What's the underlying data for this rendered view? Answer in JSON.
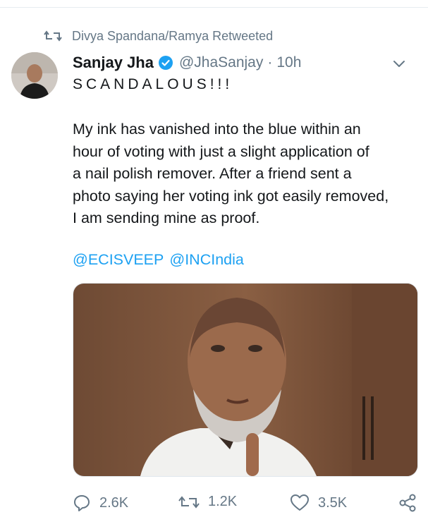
{
  "retweet": {
    "label": "Divya Spandana/Ramya Retweeted"
  },
  "tweet": {
    "author_name": "Sanjay Jha",
    "handle": "@JhaSanjay",
    "separator": "·",
    "time": "10h",
    "headline": "SCANDALOUS!!!",
    "body_lines": [
      "My ink has vanished into the blue within an",
      "hour of voting with just a slight application of",
      "a nail polish remover. After a friend sent a",
      "photo saying her voting ink got easily removed,",
      "I am sending mine as proof."
    ],
    "mentions": [
      "@ECISVEEP",
      "@INCIndia"
    ]
  },
  "actions": {
    "reply_count": "2.6K",
    "retweet_count": "1.2K",
    "like_count": "3.5K"
  },
  "colors": {
    "link": "#1da1f2",
    "muted": "#657786",
    "verified": "#1da1f2"
  }
}
